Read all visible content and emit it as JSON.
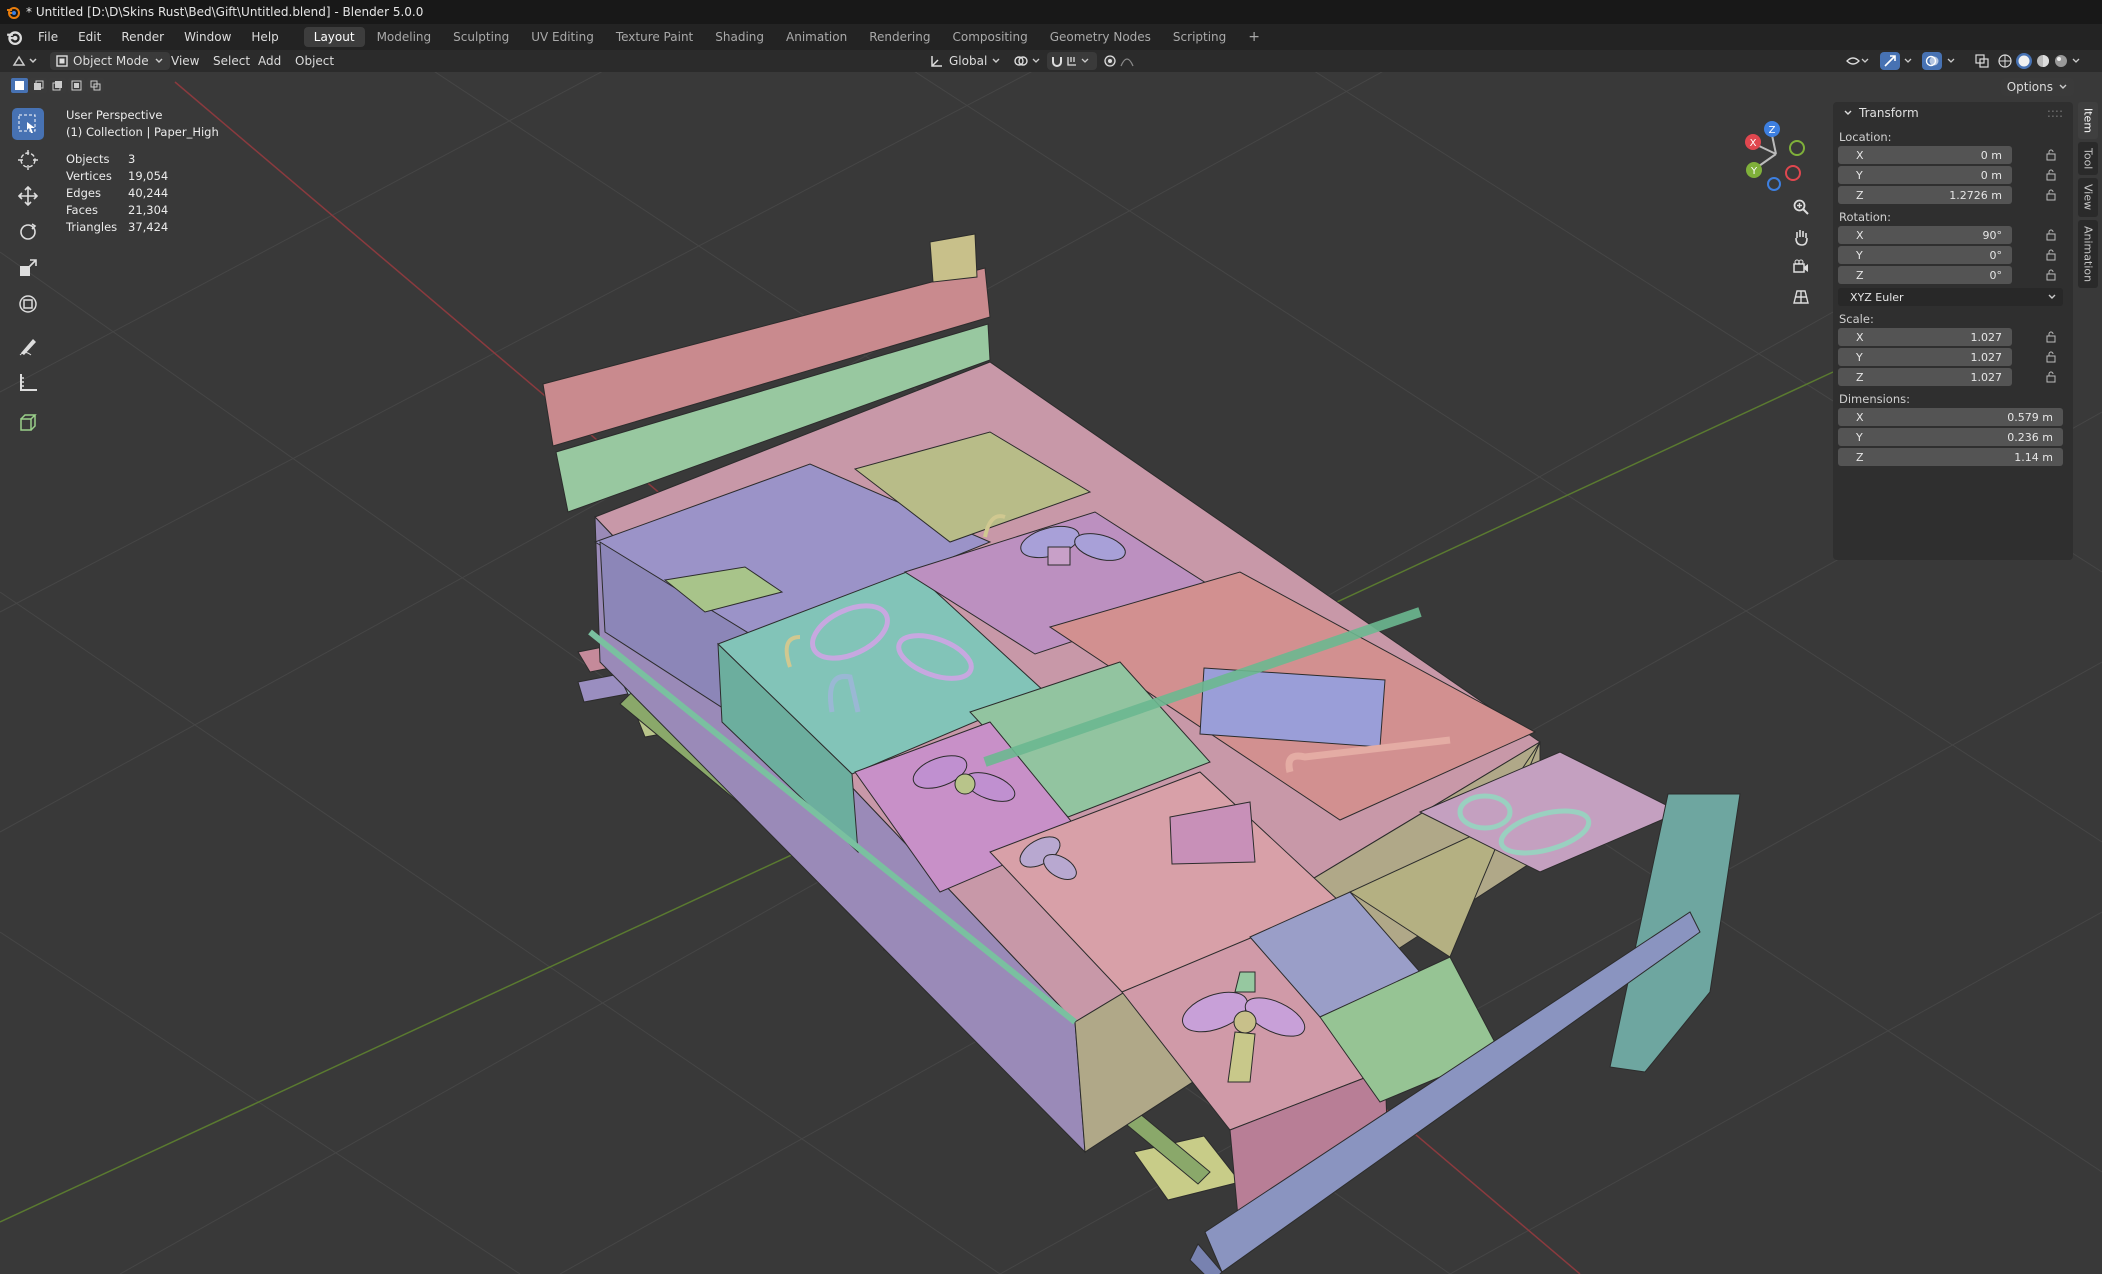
{
  "window": {
    "title": "* Untitled [D:\\D\\Skins Rust\\Bed\\Gift\\Untitled.blend] - Blender 5.0.0"
  },
  "menu": [
    "File",
    "Edit",
    "Render",
    "Window",
    "Help"
  ],
  "workspaces": {
    "tabs": [
      "Layout",
      "Modeling",
      "Sculpting",
      "UV Editing",
      "Texture Paint",
      "Shading",
      "Animation",
      "Rendering",
      "Compositing",
      "Geometry Nodes",
      "Scripting"
    ],
    "active": "Layout",
    "add_label": "+"
  },
  "header": {
    "mode": "Object Mode",
    "view": "View",
    "select": "Select",
    "add": "Add",
    "object": "Object",
    "orientation": "Global",
    "options": "Options"
  },
  "viewport": {
    "perspective": "User Perspective",
    "collection": "(1) Collection | Paper_High",
    "stats": [
      {
        "label": "Objects",
        "value": "3"
      },
      {
        "label": "Vertices",
        "value": "19,054"
      },
      {
        "label": "Edges",
        "value": "40,244"
      },
      {
        "label": "Faces",
        "value": "21,304"
      },
      {
        "label": "Triangles",
        "value": "37,424"
      }
    ],
    "gizmo": {
      "x": "X",
      "y": "Y",
      "z": "Z"
    }
  },
  "npanel": {
    "section": "Transform",
    "location_label": "Location:",
    "location": [
      {
        "axis": "X",
        "value": "0 m"
      },
      {
        "axis": "Y",
        "value": "0 m"
      },
      {
        "axis": "Z",
        "value": "1.2726 m"
      }
    ],
    "rotation_label": "Rotation:",
    "rotation": [
      {
        "axis": "X",
        "value": "90°"
      },
      {
        "axis": "Y",
        "value": "0°"
      },
      {
        "axis": "Z",
        "value": "0°"
      }
    ],
    "rotation_mode": "XYZ Euler",
    "scale_label": "Scale:",
    "scale": [
      {
        "axis": "X",
        "value": "1.027"
      },
      {
        "axis": "Y",
        "value": "1.027"
      },
      {
        "axis": "Z",
        "value": "1.027"
      }
    ],
    "dimensions_label": "Dimensions:",
    "dimensions": [
      {
        "axis": "X",
        "value": "0.579 m"
      },
      {
        "axis": "Y",
        "value": "0.236 m"
      },
      {
        "axis": "Z",
        "value": "1.14 m"
      }
    ],
    "tabs": [
      "Item",
      "Tool",
      "View",
      "Animation"
    ]
  },
  "colors": {
    "accent": "#4772b3",
    "axis_x": "#e0474f",
    "axis_y": "#7fb03a",
    "axis_z": "#3d7fe0",
    "viewport_bg": "#393939"
  }
}
